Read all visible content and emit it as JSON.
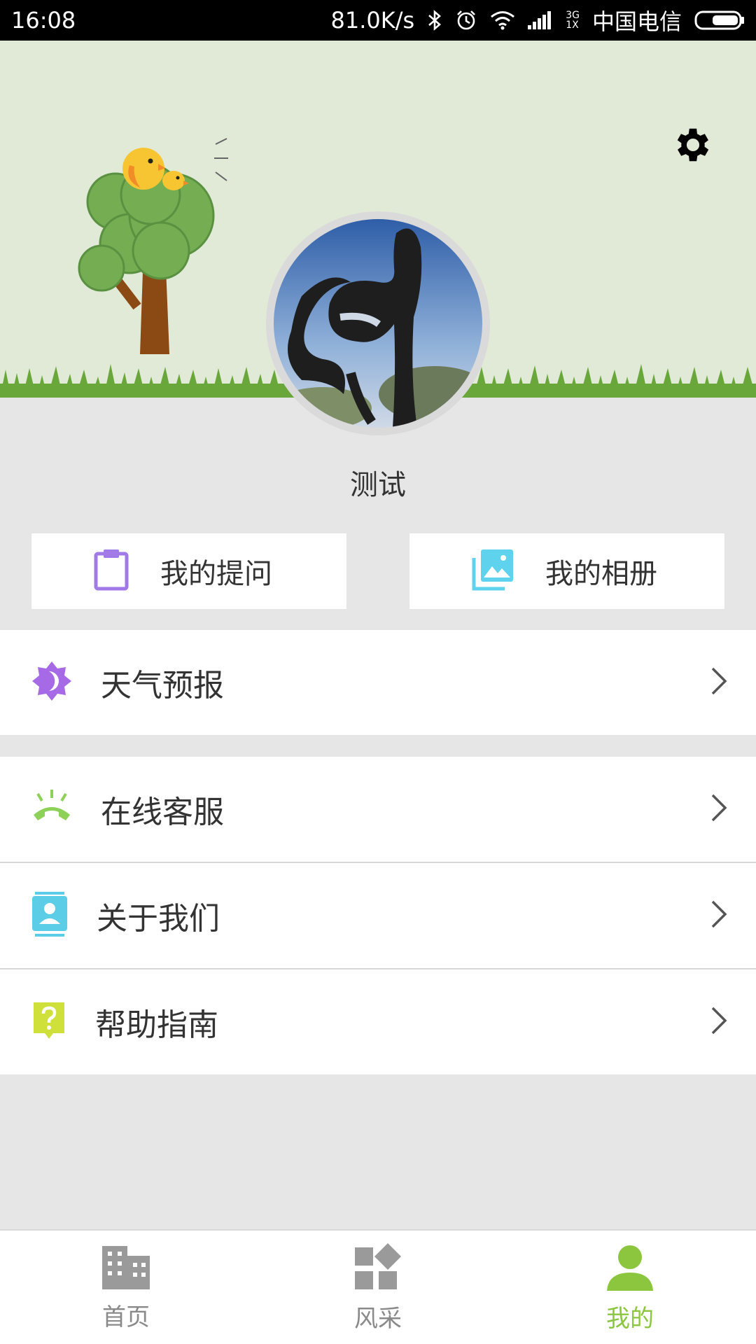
{
  "status_bar": {
    "time": "16:08",
    "speed": "81.0K/s",
    "network_top": "3G",
    "network_bottom": "1X",
    "carrier": "中国电信"
  },
  "profile": {
    "username": "测试"
  },
  "cards": {
    "questions_label": "我的提问",
    "album_label": "我的相册"
  },
  "menu": {
    "weather_label": "天气预报",
    "service_label": "在线客服",
    "about_label": "关于我们",
    "help_label": "帮助指南"
  },
  "nav": {
    "home_label": "首页",
    "style_label": "风采",
    "mine_label": "我的",
    "active_color": "#8cc63f",
    "inactive_color": "#8a8a8a"
  },
  "icons": {
    "settings": "gear-icon",
    "questions": "clipboard-icon",
    "album": "photo-album-icon",
    "weather": "weather-sun-moon-icon",
    "service": "phone-ringing-icon",
    "about": "contact-card-icon",
    "help": "help-question-icon",
    "home": "building-icon",
    "style": "widgets-icon",
    "mine": "person-icon"
  }
}
